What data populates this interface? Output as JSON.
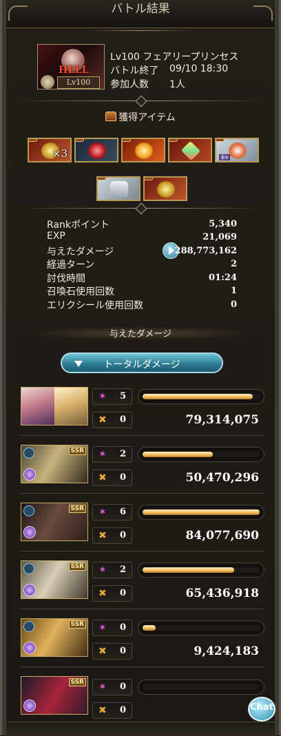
{
  "header": {
    "title": "バトル結果"
  },
  "quest": {
    "difficulty_label": "HELL",
    "level_badge": "Lv100",
    "name": "Lv100 フェアリープリンセス",
    "end_label": "バトル終了",
    "end_time": "09/10 18:30",
    "participants_label": "参加人数",
    "participants": "1人"
  },
  "items": {
    "title": "獲得アイテム",
    "row1": [
      {
        "icon": "gold-medal-icon",
        "qty": "×3"
      },
      {
        "icon": "red-crystal-icon"
      },
      {
        "icon": "fire-orb-icon"
      },
      {
        "icon": "prism-crystal-icon"
      },
      {
        "icon": "card-icon",
        "tag": "運命"
      }
    ],
    "row2": [
      {
        "icon": "lyre-icon"
      },
      {
        "icon": "gold-medal-icon"
      }
    ]
  },
  "stats": [
    {
      "label": "Rankポイント",
      "value": "5,340"
    },
    {
      "label": "EXP",
      "value": "21,069"
    },
    {
      "label": "与えたダメージ",
      "value": "288,773,162"
    },
    {
      "label": "経過ターン",
      "value": "2"
    },
    {
      "label": "討伐時間",
      "value": "01:24"
    },
    {
      "label": "召喚石使用回数",
      "value": "1"
    },
    {
      "label": "エリクシール使用回数",
      "value": "0"
    }
  ],
  "damage": {
    "heading": "与えたダメージ",
    "total_button": "トータルダメージ",
    "members": [
      {
        "name": "party-member-1",
        "ssr": "",
        "hits": "5",
        "ca": "0",
        "damage": "79,314,075",
        "ratio": 0.94
      },
      {
        "name": "party-member-2",
        "ssr": "SSR",
        "hits": "2",
        "ca": "0",
        "damage": "50,470,296",
        "ratio": 0.6
      },
      {
        "name": "party-member-3",
        "ssr": "SSR",
        "hits": "6",
        "ca": "0",
        "damage": "84,077,690",
        "ratio": 1.0
      },
      {
        "name": "party-member-4",
        "ssr": "SSR",
        "hits": "2",
        "ca": "0",
        "damage": "65,436,918",
        "ratio": 0.78
      },
      {
        "name": "party-member-5",
        "ssr": "SSR",
        "hits": "0",
        "ca": "0",
        "damage": "9,424,183",
        "ratio": 0.11
      },
      {
        "name": "party-member-6",
        "ssr": "SSR",
        "hits": "0",
        "ca": "0",
        "damage": "",
        "ratio": 0.0
      }
    ]
  },
  "chat": {
    "label": "Chat"
  },
  "colors": {
    "accent": "#f0b955",
    "button": "#2f7d95",
    "hit_icon": "#e75fe0",
    "ca_icon": "#e2a93b"
  }
}
